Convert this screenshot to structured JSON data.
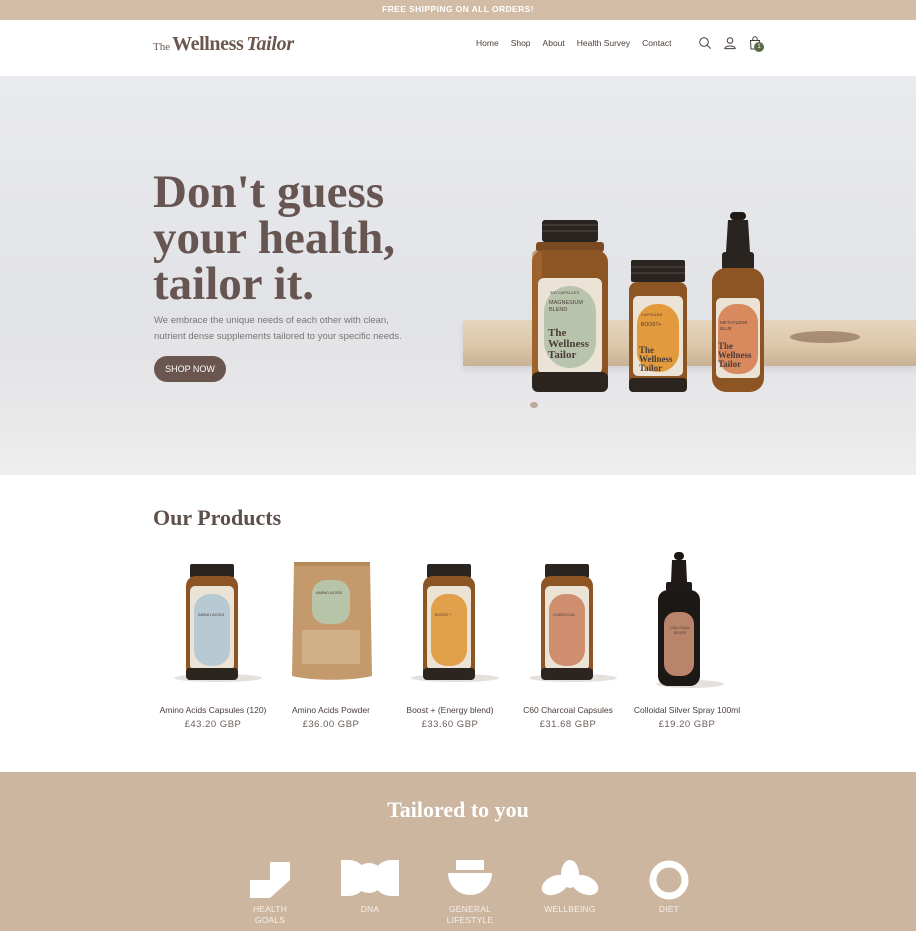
{
  "announcement": "FREE SHIPPING ON ALL ORDERS!",
  "brand": {
    "the": "The",
    "wellness": "Wellness",
    "tailor": "Tailor"
  },
  "nav": [
    "Home",
    "Shop",
    "About",
    "Health Survey",
    "Contact"
  ],
  "header_icons": [
    "search-icon",
    "account-icon",
    "cart-icon"
  ],
  "cart_count": "1",
  "hero": {
    "title_lines": [
      "Don't guess",
      "your health,",
      "tailor it."
    ],
    "subtitle_lines": [
      "We embrace the unique needs of each other with clean,",
      "nutrient dense supplements tailored to your specific needs."
    ],
    "cta": "SHOP NOW",
    "bottles": [
      {
        "top": "300 CAPSULES",
        "name": "MAGNESIUM BLEND",
        "brand": "The Wellness Tailor",
        "label_color": "#b9c4ad"
      },
      {
        "top": "CAPSULES",
        "name": "BOOST+",
        "brand": "The Wellness Tailor",
        "label_color": "#e39a3c"
      },
      {
        "top": "",
        "name": "METHYLENE BLUE",
        "brand": "The Wellness Tailor",
        "label_color": "#d9895e"
      }
    ]
  },
  "products_section": {
    "title": "Our Products",
    "items": [
      {
        "name": "Amino Acids Capsules (120)",
        "price": "£43.20 GBP",
        "label_color": "#b7cad3",
        "kind": "jar",
        "label": "AMINO ACIDS"
      },
      {
        "name": "Amino Acids Powder",
        "price": "£36.00 GBP",
        "label_color": "#b7c4a8",
        "kind": "pouch",
        "label": "AMINO ACIDS"
      },
      {
        "name": "Boost + (Energy blend)",
        "price": "£33.60 GBP",
        "label_color": "#e3a04a",
        "kind": "jar",
        "label": "BOOST+"
      },
      {
        "name": "C60 Charcoal Capsules",
        "price": "£31.68 GBP",
        "label_color": "#cf8f6f",
        "kind": "jar",
        "label": "CHARCOAL"
      },
      {
        "name": "Colloidal Silver Spray 100ml",
        "price": "£19.20 GBP",
        "label_color": "#b9846a",
        "kind": "dropper",
        "label": "COLLOIDAL SILVER"
      }
    ]
  },
  "tailored": {
    "title": "Tailored to you",
    "features": [
      {
        "label": "HEALTH\nGOALS",
        "icon": "health-goals-icon"
      },
      {
        "label": "DNA",
        "icon": "dna-icon"
      },
      {
        "label": "GENERAL\nLIFESTYLE",
        "icon": "general-lifestyle-icon"
      },
      {
        "label": "WELLBEING",
        "icon": "wellbeing-icon"
      },
      {
        "label": "DIET",
        "icon": "diet-icon"
      }
    ]
  },
  "colors": {
    "announcement_bg": "#d2bca6",
    "accent_brown": "#6b554f",
    "tailored_bg": "#cdb6a0",
    "cart_badge": "#5b6b47"
  }
}
